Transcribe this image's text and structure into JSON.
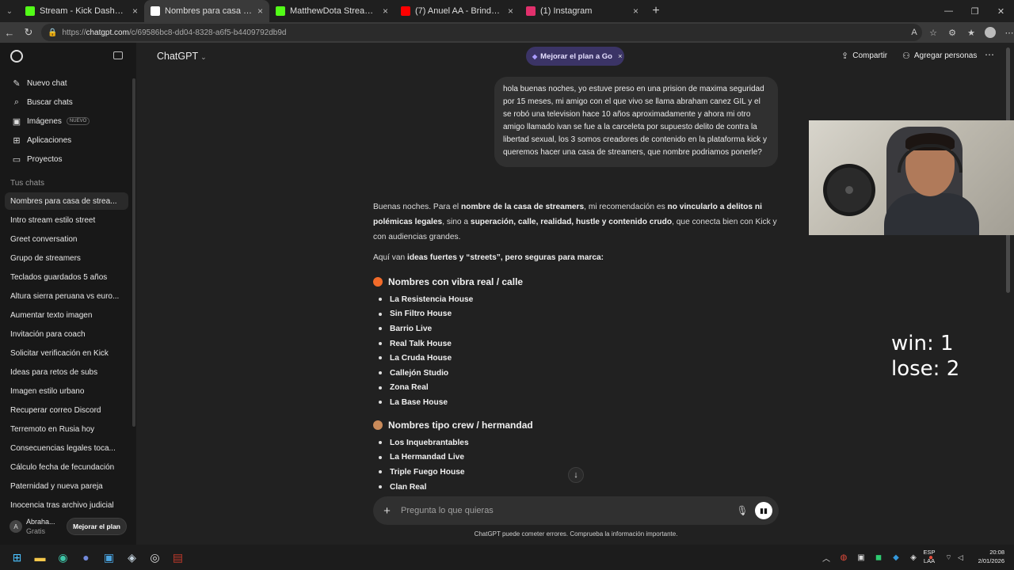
{
  "browser": {
    "tabs": [
      {
        "title": "Stream - Kick Dashboard",
        "icon": "kick-icon",
        "color": "#53fc18"
      },
      {
        "title": "Nombres para casa de streamers",
        "icon": "chatgpt-icon",
        "color": "#ffffff",
        "active": true
      },
      {
        "title": "MatthewDota Stream - Watch Live",
        "icon": "kick-icon",
        "color": "#53fc18"
      },
      {
        "title": "(7) Anuel AA - Brindemos feat. Oz",
        "icon": "youtube-icon",
        "color": "#ff0000"
      },
      {
        "title": "(1) Instagram",
        "icon": "instagram-icon",
        "color": "#e1306c"
      }
    ],
    "url_scheme": "https://",
    "url_host": "chatgpt.com",
    "url_path": "/c/69586bc8-dd04-8328-a6f5-b4409792db9d"
  },
  "sidebar": {
    "nav": [
      {
        "label": "Nuevo chat",
        "icon": "compose-icon"
      },
      {
        "label": "Buscar chats",
        "icon": "search-icon"
      },
      {
        "label": "Imágenes",
        "icon": "image-icon",
        "badge": "NUEVO"
      },
      {
        "label": "Aplicaciones",
        "icon": "apps-icon"
      },
      {
        "label": "Proyectos",
        "icon": "folder-icon"
      }
    ],
    "section_label": "Tus chats",
    "chats": [
      "Nombres para casa de strea...",
      "Intro stream estilo street",
      "Greet conversation",
      "Grupo de streamers",
      "Teclados guardados 5 años",
      "Altura sierra peruana vs euro...",
      "Aumentar texto imagen",
      "Invitación para coach",
      "Solicitar verificación en Kick",
      "Ideas para retos de subs",
      "Imagen estilo urbano",
      "Recuperar correo Discord",
      "Terremoto en Rusia hoy",
      "Consecuencias legales toca...",
      "Cálculo fecha de fecundación",
      "Paternidad y nueva pareja",
      "Inocencia tras archivo judicial"
    ],
    "user_initials": "A",
    "user_name": "Abraha...",
    "user_plan": "Gratis",
    "upgrade_label": "Mejorar el plan"
  },
  "header": {
    "model": "ChatGPT",
    "promo": "Mejorar el plan a Go",
    "share": "Compartir",
    "add_people": "Agregar personas"
  },
  "conversation": {
    "user_message": "hola buenas noches, yo estuve preso en una prision de maxima seguridad  por 15 meses,  mi amigo con el que vivo se llama  abraham canez GIL y el se robó una television  hace 10 años aproximadamente y ahora mi otro amigo llamado ivan  se fue a la carceleta por  supuesto delito de contra la libertad sexual,   los 3 somos  creadores de contenido en la plataforma kick  y  queremos hacer una  casa de streamers,  que nombre podriamos ponerle?",
    "reply_p1": [
      {
        "t": "Buenas noches. Para el ",
        "b": false
      },
      {
        "t": "nombre de la casa de streamers",
        "b": true
      },
      {
        "t": ", mi recomendación es ",
        "b": false
      },
      {
        "t": "no vincularlo a delitos ni polémicas legales",
        "b": true
      },
      {
        "t": ", sino a ",
        "b": false
      },
      {
        "t": "superación, calle, realidad, hustle y contenido crudo",
        "b": true
      },
      {
        "t": ", que conecta bien con Kick y con audiencias grandes.",
        "b": false
      }
    ],
    "reply_p2_plain": "Aquí van ",
    "reply_p2_bold": "ideas fuertes y “streets”, pero seguras para marca:",
    "sections": [
      {
        "title": "Nombres con vibra real / calle",
        "emoji": "fire-icon",
        "emoji_color": "#f26b2a",
        "items": [
          "La Resistencia House",
          "Sin Filtro House",
          "Barrio Live",
          "Real Talk House",
          "La Cruda House",
          "Callejón Studio",
          "Zona Real",
          "La Base House"
        ]
      },
      {
        "title": "Nombres tipo crew / hermandad",
        "emoji": "house-icon",
        "emoji_color": "#c98a5a",
        "items": [
          "Los Inquebrantables",
          "La Hermandad Live",
          "Triple Fuego House",
          "Clan Real"
        ]
      }
    ]
  },
  "composer": {
    "placeholder": "Pregunta lo que quieras",
    "disclaimer": "ChatGPT puede cometer errores. Comprueba la información importante."
  },
  "overlay": {
    "score_win": "win: 1",
    "score_lose": "lose: 2"
  },
  "taskbar": {
    "lang_line1": "ESP",
    "lang_line2": "LAA",
    "time": "20:08",
    "date": "2/01/2026"
  }
}
